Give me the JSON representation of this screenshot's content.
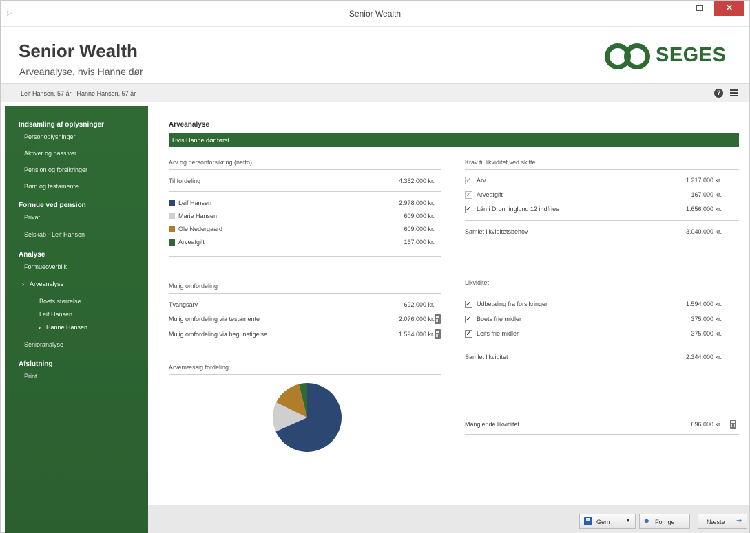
{
  "window": {
    "title": "Senior Wealth"
  },
  "header": {
    "title": "Senior Wealth",
    "subtitle": "Arveanalyse, hvis Hanne dør",
    "logo_text": "SEGES"
  },
  "infobar": {
    "persons": "Leif Hansen, 57 år - Hanne Hansen, 57 år"
  },
  "sidebar": {
    "groups": [
      {
        "label": "Indsamling af oplysninger",
        "items": [
          "Personoplysninger",
          "Aktiver og passiver",
          "Pension og forsikringer",
          "Børn og testamente"
        ]
      },
      {
        "label": "Formue ved pension",
        "items": [
          "Privat",
          "Selskab - Leif Hansen"
        ]
      },
      {
        "label": "Analyse",
        "items": [
          "Formueoverblik",
          "Arveanalyse",
          "Boets størrelse",
          "Leif Hansen",
          "Hanne Hansen",
          "Senioranalyse"
        ]
      },
      {
        "label": "Afslutning",
        "items": [
          "Print"
        ]
      }
    ],
    "active_items": [
      "Arveanalyse",
      "Hanne Hansen"
    ]
  },
  "main": {
    "section_title": "Arveanalyse",
    "banner": "Hvis Hanne dør først",
    "arv": {
      "heading": "Arv og personforsikring (netto)",
      "total_label": "Til fordeling",
      "total_value": "4.362.000 kr.",
      "items": [
        {
          "label": "Leif Hansen",
          "value": "2.978.000 kr.",
          "color": "#2c4772"
        },
        {
          "label": "Marie Hansen",
          "value": "609.000 kr.",
          "color": "#cfcfcf"
        },
        {
          "label": "Ole Nedergaard",
          "value": "609.000 kr.",
          "color": "#b07d2a"
        },
        {
          "label": "Arveafgift",
          "value": "167.000 kr.",
          "color": "#2f6a34"
        }
      ]
    },
    "omfordeling": {
      "heading": "Mulig omfordeling",
      "items": [
        {
          "label": "Tvangsarv",
          "value": "692.000 kr."
        },
        {
          "label": "Mulig omfordeling via testamente",
          "value": "2.076.000 kr."
        },
        {
          "label": "Mulig omfordeling via begunstigelse",
          "value": "1.594.000 kr."
        }
      ]
    },
    "arvemaessig": {
      "heading": "Arvemæssig fordeling"
    },
    "krav": {
      "heading": "Krav til likviditet ved skifte",
      "items": [
        {
          "label": "Arv",
          "value": "1.217.000 kr."
        },
        {
          "label": "Arveafgift",
          "value": "167.000 kr."
        },
        {
          "label": "Lån i Dronninglund 12 indfries",
          "value": "1.656.000 kr."
        }
      ],
      "total_label": "Samlet likviditetsbehov",
      "total_value": "3.040.000 kr."
    },
    "likviditet": {
      "heading": "Likviditet",
      "items": [
        {
          "label": "Udbetaling fra forsikringer",
          "value": "1.594.000 kr."
        },
        {
          "label": "Boets frie midler",
          "value": "375.000 kr."
        },
        {
          "label": "Leifs frie midler",
          "value": "375.000 kr."
        }
      ],
      "total_label": "Samlet likviditet",
      "total_value": "2.344.000 kr."
    },
    "manglende": {
      "label": "Manglende likviditet",
      "value": "696.000 kr."
    }
  },
  "chart_data": {
    "type": "pie",
    "categories": [
      "Leif Hansen",
      "Marie Hansen",
      "Ole Nedergaard",
      "Arveafgift"
    ],
    "values": [
      2978000,
      609000,
      609000,
      167000
    ],
    "colors": [
      "#2c4772",
      "#cfcfcf",
      "#b07d2a",
      "#2f6a34"
    ]
  },
  "footer": {
    "save_label": "Gem",
    "prev_label": "Forrige",
    "next_label": "Næste"
  }
}
